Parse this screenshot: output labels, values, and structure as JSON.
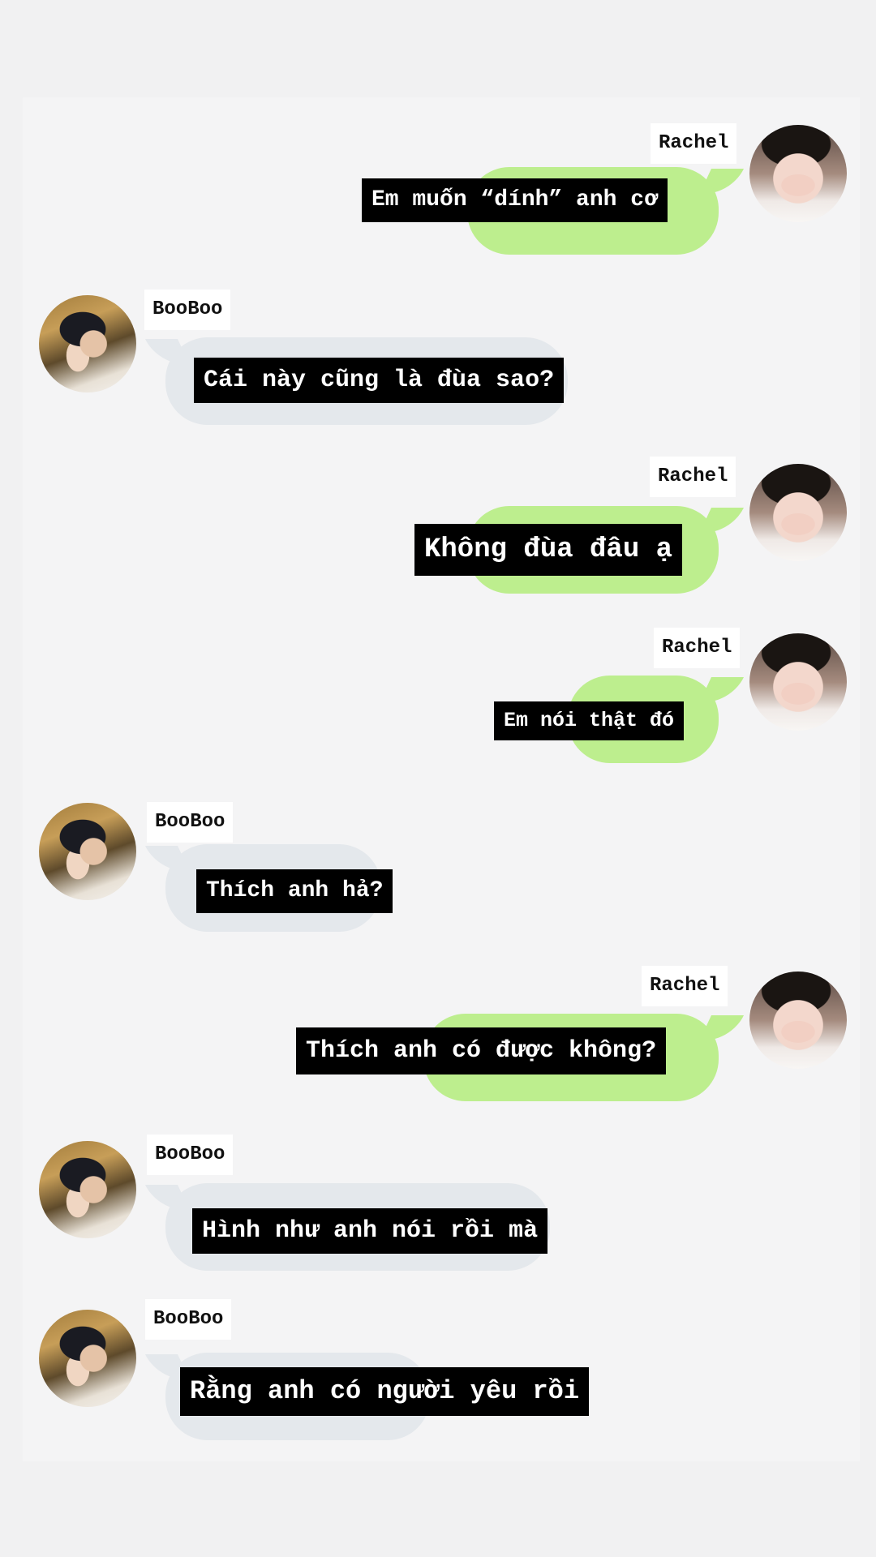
{
  "messages": [
    {
      "sender": "Rachel",
      "side": "right",
      "text": "Em muốn “dính” anh cơ"
    },
    {
      "sender": "BooBoo",
      "side": "left",
      "text": "Cái này cũng là đùa sao?"
    },
    {
      "sender": "Rachel",
      "side": "right",
      "text": "Không đùa đâu ạ"
    },
    {
      "sender": "Rachel",
      "side": "right",
      "text": "Em nói thật đó"
    },
    {
      "sender": "BooBoo",
      "side": "left",
      "text": "Thích anh hả?"
    },
    {
      "sender": "Rachel",
      "side": "right",
      "text": "Thích anh có được không?"
    },
    {
      "sender": "BooBoo",
      "side": "left",
      "text": "Hình như anh nói rồi mà"
    },
    {
      "sender": "BooBoo",
      "side": "left",
      "text": "Rằng anh có người yêu rồi"
    }
  ],
  "colors": {
    "background": "#f1f1f2",
    "panel": "#f4f4f5",
    "bubble_right": "#bdee8e",
    "bubble_left": "#e4e8ec",
    "caption_bg": "#000000",
    "caption_text": "#ffffff"
  },
  "icons": {
    "avatar_rachel": "avatar-photo",
    "avatar_booboo": "avatar-photo"
  }
}
